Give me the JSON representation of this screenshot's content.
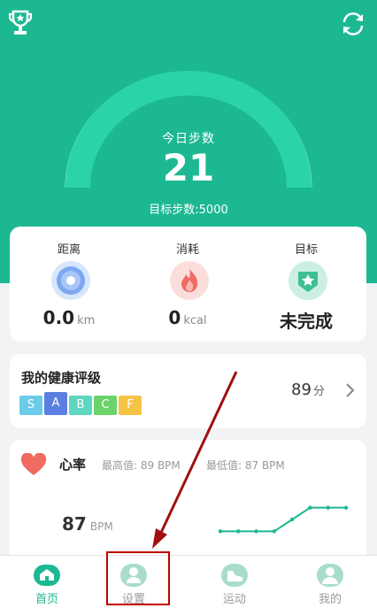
{
  "header": {
    "steps_label": "今日步数",
    "steps_value": "21",
    "target_steps": "目标步数:5000"
  },
  "stats": [
    {
      "label": "距离",
      "value": "0.0",
      "unit": "km",
      "icon": "location-icon"
    },
    {
      "label": "消耗",
      "value": "0",
      "unit": "kcal",
      "icon": "flame-icon"
    },
    {
      "label": "目标",
      "value": "未完成",
      "unit": "",
      "icon": "star-badge-icon"
    }
  ],
  "health_rating": {
    "title": "我的健康评级",
    "grades": [
      "S",
      "A",
      "B",
      "C",
      "F"
    ],
    "grade_colors": [
      "#6ccbe8",
      "#5b7fe0",
      "#5ed6c0",
      "#6ad36a",
      "#f6c445"
    ],
    "score": "89",
    "unit": "分"
  },
  "heart_rate": {
    "title": "心率",
    "max_label": "最高值: 89 BPM",
    "min_label": "最低值: 87 BPM",
    "value": "87",
    "unit": "BPM",
    "trend": [
      87,
      87,
      87,
      87,
      88,
      89,
      89,
      89
    ]
  },
  "tabbar": {
    "items": [
      {
        "label": "首页",
        "active": true
      },
      {
        "label": "设置",
        "active": false
      },
      {
        "label": "运动",
        "active": false
      },
      {
        "label": "我的",
        "active": false
      }
    ]
  },
  "colors": {
    "primary": "#1cb892",
    "annotation": "#c00000"
  }
}
